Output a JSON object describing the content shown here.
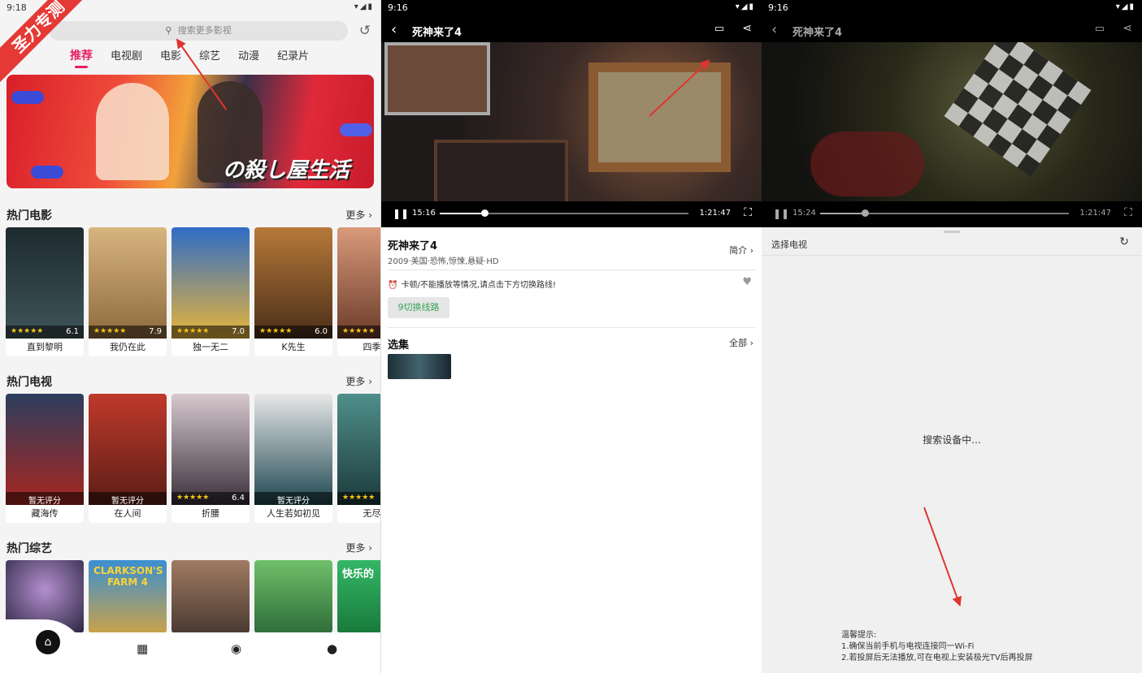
{
  "home": {
    "status_time": "9:18",
    "corner_label": "圣力专测",
    "search_placeholder": "搜索更多影视",
    "tabs": [
      "推荐",
      "电视剧",
      "电影",
      "综艺",
      "动漫",
      "纪录片"
    ],
    "banner_title": "の殺し屋生活",
    "sections": [
      {
        "title": "热门电影",
        "more": "更多",
        "items": [
          {
            "name": "直到黎明",
            "stars": "★★★★★",
            "score": "6.1",
            "color": "#2b3a3e"
          },
          {
            "name": "我仍在此",
            "stars": "★★★★★",
            "score": "7.9",
            "color": "#c7a36c"
          },
          {
            "name": "独一无二",
            "stars": "★★★★★",
            "score": "7.0",
            "color": "#2e6cc7"
          },
          {
            "name": "K先生",
            "stars": "★★★★★",
            "score": "6.0",
            "color": "#7a4a22"
          },
          {
            "name": "四季之",
            "stars": "★★★★★",
            "score": "",
            "color": "#b36a4a"
          }
        ]
      },
      {
        "title": "热门电视",
        "more": "更多",
        "items": [
          {
            "name": "藏海传",
            "stars": "",
            "score": "暂无评分",
            "color": "#8a1f1f"
          },
          {
            "name": "在人间",
            "stars": "",
            "score": "暂无评分",
            "color": "#a8322a"
          },
          {
            "name": "折腰",
            "stars": "★★★★★",
            "score": "6.4",
            "color": "#4a3f52"
          },
          {
            "name": "人生若如初见",
            "stars": "",
            "score": "暂无评分",
            "color": "#1f4852"
          },
          {
            "name": "无尽的",
            "stars": "★★★★★",
            "score": "",
            "color": "#2c6b6e"
          }
        ]
      },
      {
        "title": "热门综艺",
        "more": "更多",
        "items": [
          {
            "name": "",
            "color": "#3a3558"
          },
          {
            "name": "CLARKSON'S FARM 4",
            "color": "#3a8fd1"
          },
          {
            "name": "",
            "color": "#8a6b55"
          },
          {
            "name": "",
            "color": "#3a8a4a"
          },
          {
            "name": "快乐的",
            "color": "#2aa05a"
          }
        ]
      }
    ]
  },
  "player": {
    "status_time": "9:16",
    "title": "死神来了4",
    "current_time": "15:16",
    "duration": "1:21:47",
    "progress": 0.18,
    "meta": "2009·美国·恐怖,惊悚,悬疑·HD",
    "intro": "简介",
    "tip": "卡顿/不能播放等情况,请点击下方切换路线!",
    "switch_line": "9切换线路",
    "episodes_title": "选集",
    "episodes_all": "全部"
  },
  "cast": {
    "status_time": "9:16",
    "title": "死神来了4",
    "current_time": "15:24",
    "duration": "1:21:47",
    "progress": 0.18,
    "select_tv": "选择电视",
    "searching": "搜索设备中...",
    "notes_title": "温馨提示:",
    "note1": "1.确保当前手机与电视连接同一Wi-Fi",
    "note2": "2.若投屏后无法播放,可在电视上安装极光TV后再投屏"
  }
}
